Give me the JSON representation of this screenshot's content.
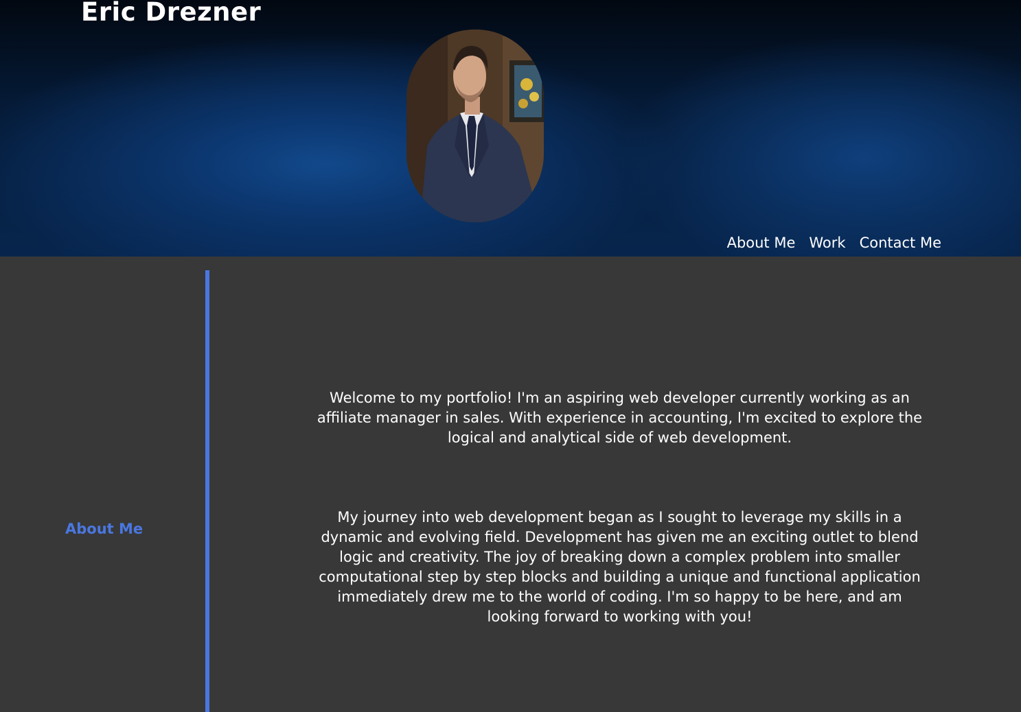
{
  "header": {
    "title": "Eric Drezner",
    "nav": [
      {
        "label": "About Me"
      },
      {
        "label": "Work"
      },
      {
        "label": "Contact Me"
      }
    ]
  },
  "about": {
    "heading": "About Me",
    "paragraphs": [
      "Welcome to my portfolio! I'm an aspiring web developer currently working as an affiliate manager in sales. With experience in accounting, I'm excited to explore the logical and analytical side of web development.",
      "My journey into web development began as I sought to leverage my skills in a dynamic and evolving field. Development has given me an exciting outlet to blend logic and creativity. The joy of breaking down a complex problem into smaller computational step by step blocks and building a unique and functional application immediately drew me to the world of coding. I'm so happy to be here, and am looking forward to working with you!"
    ]
  },
  "colors": {
    "accent": "#4a77e0",
    "background": "#383838",
    "header_dark": "#020811",
    "header_blue": "#12498b",
    "text": "#ffffff"
  }
}
